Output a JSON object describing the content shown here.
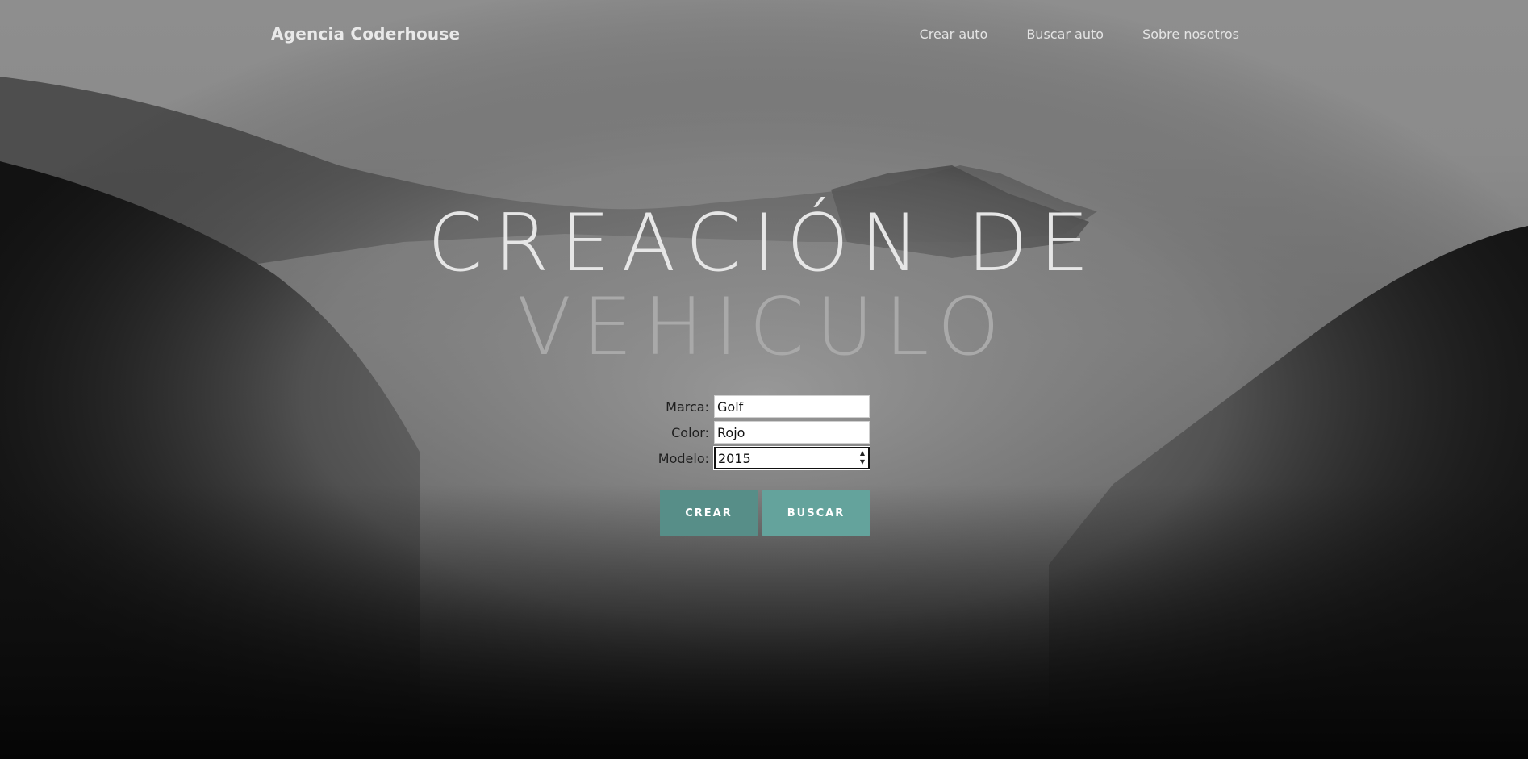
{
  "navbar": {
    "brand": "Agencia Coderhouse",
    "links": [
      "Crear auto",
      "Buscar auto",
      "Sobre nosotros"
    ]
  },
  "hero": {
    "title_line1": "Creación de",
    "title_line2": "Vehiculo"
  },
  "form": {
    "marca_label": "Marca:",
    "marca_value": "Golf",
    "color_label": "Color:",
    "color_value": "Rojo",
    "modelo_label": "Modelo:",
    "modelo_value": "2015"
  },
  "buttons": {
    "crear": "Crear",
    "buscar": "Buscar"
  },
  "colors": {
    "accent_dark": "#578e88",
    "accent_light": "#64a39c"
  },
  "icons": {
    "stepper": "number-stepper-icon"
  }
}
